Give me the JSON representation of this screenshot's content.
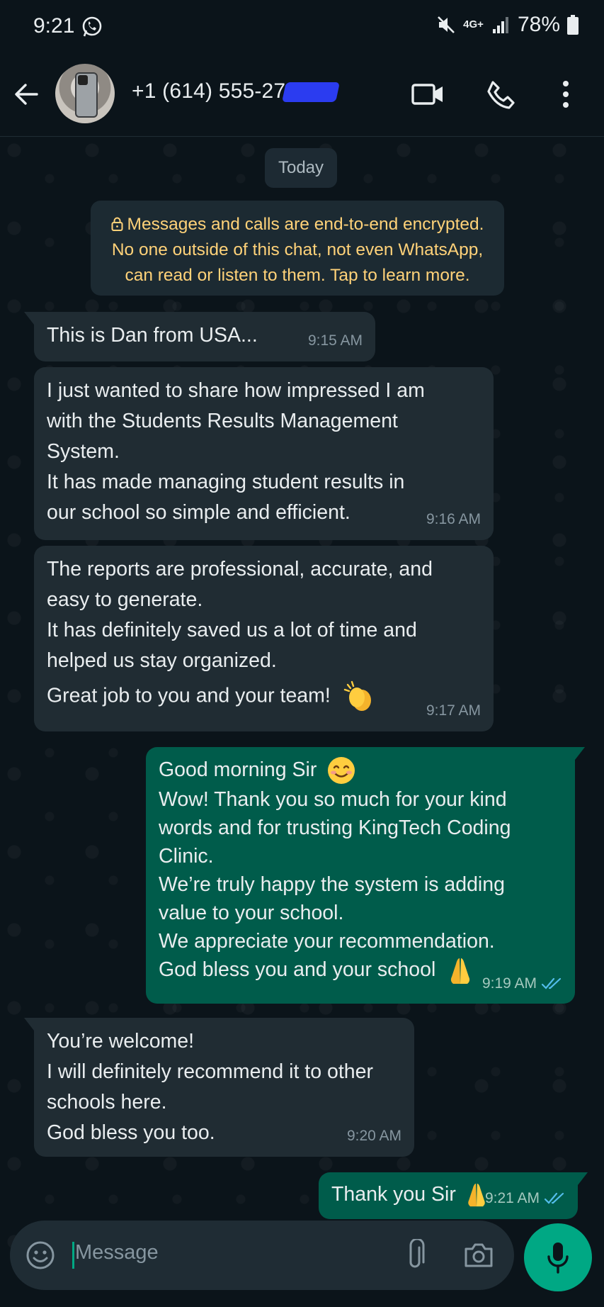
{
  "status_bar": {
    "time": "9:21",
    "network": "4G+",
    "battery": "78%"
  },
  "header": {
    "contact": "+1 (614) 555-27"
  },
  "chat": {
    "date_chip": "Today",
    "encryption_notice": [
      "Messages and calls are end-to-end encrypted.",
      "No one outside of this chat, not even WhatsApp,",
      "can read or listen to them. Tap to learn more."
    ],
    "messages": [
      {
        "direction": "incoming",
        "lines": [
          "This is Dan from USA..."
        ],
        "time": "9:15 AM"
      },
      {
        "direction": "incoming",
        "lines": [
          "I just wanted to share how impressed I am",
          "with the Students Results Management",
          "System.",
          "It has made managing student results in",
          "our school so simple and efficient."
        ],
        "time": "9:16 AM"
      },
      {
        "direction": "incoming",
        "lines": [
          "The reports are professional, accurate, and",
          "easy to generate.",
          "It has definitely saved us a lot of time and",
          "helped us stay organized.",
          "Great job to you and your team!"
        ],
        "emoji": "clapping-hands",
        "time": "9:17 AM"
      },
      {
        "direction": "outgoing",
        "lines": [
          "Good morning Sir",
          "Wow! Thank you so much for your kind",
          "words and for trusting KingTech Coding",
          "Clinic.",
          "We’re truly happy the system is adding",
          "value to your school.",
          "We appreciate your recommendation.",
          "God bless you and your school"
        ],
        "emojis": [
          "smiling-face",
          "folded-hands"
        ],
        "time": "9:19 AM",
        "status": "read"
      },
      {
        "direction": "incoming",
        "lines": [
          "You’re welcome!",
          "I will definitely recommend it to other",
          "schools here.",
          "God bless you too."
        ],
        "time": "9:20 AM"
      },
      {
        "direction": "outgoing",
        "lines": [
          "Thank you Sir"
        ],
        "emoji": "folded-hands",
        "time": "9:21 AM",
        "status": "read"
      }
    ]
  },
  "input": {
    "placeholder": "Message"
  },
  "colors": {
    "background": "#0b141a",
    "incoming_bubble": "#202c33",
    "outgoing_bubble": "#005c4b",
    "accent": "#00a884",
    "read_ticks": "#53bdeb",
    "encryption_text": "#ffd279"
  },
  "icons": [
    "whatsapp-icon",
    "mute-icon",
    "signal-icon",
    "battery-icon",
    "back-arrow-icon",
    "video-call-icon",
    "voice-call-icon",
    "more-options-icon",
    "lock-icon",
    "double-check-icon",
    "emoji-icon",
    "attach-icon",
    "camera-icon",
    "mic-icon"
  ]
}
